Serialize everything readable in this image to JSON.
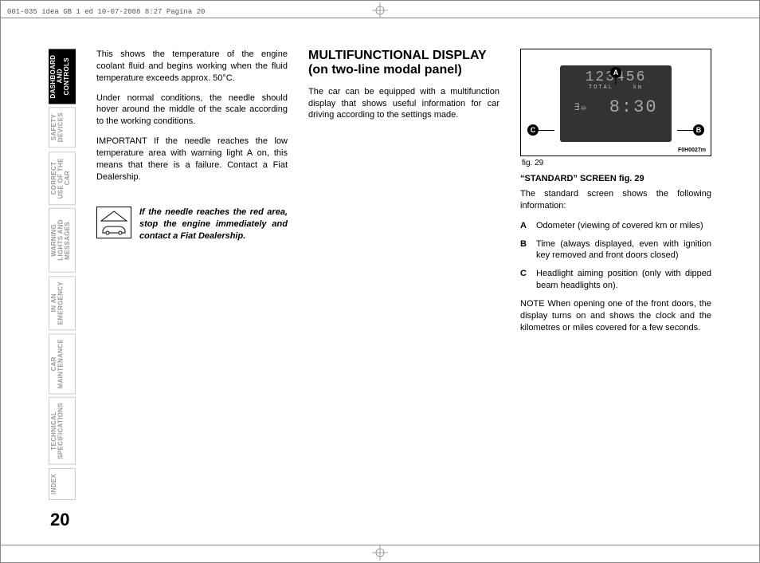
{
  "meta": {
    "crop_line": "001-035 idea GB 1 ed  10-07-2008  8:27  Pagina 20"
  },
  "tabs": [
    "DASHBOARD AND CONTROLS",
    "SAFETY DEVICES",
    "CORRECT USE OF THE CAR",
    "WARNING LIGHTS AND MESSAGES",
    "IN AN EMERGENCY",
    "CAR MAINTENANCE",
    "TECHNICAL SPECIFICATIONS",
    "INDEX"
  ],
  "page_number": "20",
  "col1": {
    "p1": "This shows the temperature of the engine coolant fluid and begins working when the fluid temperature exceeds approx. 50°C.",
    "p2": "Under normal conditions, the needle should hover around the middle of the scale according to the working conditions.",
    "p3": "IMPORTANT If the needle reaches the low temperature area with warning light A on, this means that there is a failure. Contact a Fiat Dealership.",
    "warning": "If the needle reaches the red area, stop the engine immediately and contact a Fiat Dealership."
  },
  "col2": {
    "heading": "MULTIFUNCTIONAL DISPLAY\n(on two-line modal panel)",
    "p1": "The car can be equipped with a multifunction display that shows useful information for car driving according to the settings made."
  },
  "col3": {
    "figure": {
      "odo": "123456",
      "odo_label_total": "TOTAL",
      "odo_label_km": "km",
      "headlamp": "∃⦵",
      "clock": "8:30",
      "callouts": {
        "a": "A",
        "b": "B",
        "c": "C"
      },
      "ref": "F0H0027m",
      "caption": "fig. 29"
    },
    "subheading": "“STANDARD” SCREEN fig. 29",
    "intro": "The standard screen shows the following information:",
    "items": [
      {
        "label": "A",
        "text": "Odometer (viewing of covered km or miles)"
      },
      {
        "label": "B",
        "text": "Time (always displayed, even with ignition key removed and front doors closed)"
      },
      {
        "label": "C",
        "text": "Headlight aiming position (only with dipped beam headlights on)."
      }
    ],
    "note": "NOTE When opening one of the front doors, the display turns on and shows the clock and the kilometres or miles covered for a few seconds."
  }
}
